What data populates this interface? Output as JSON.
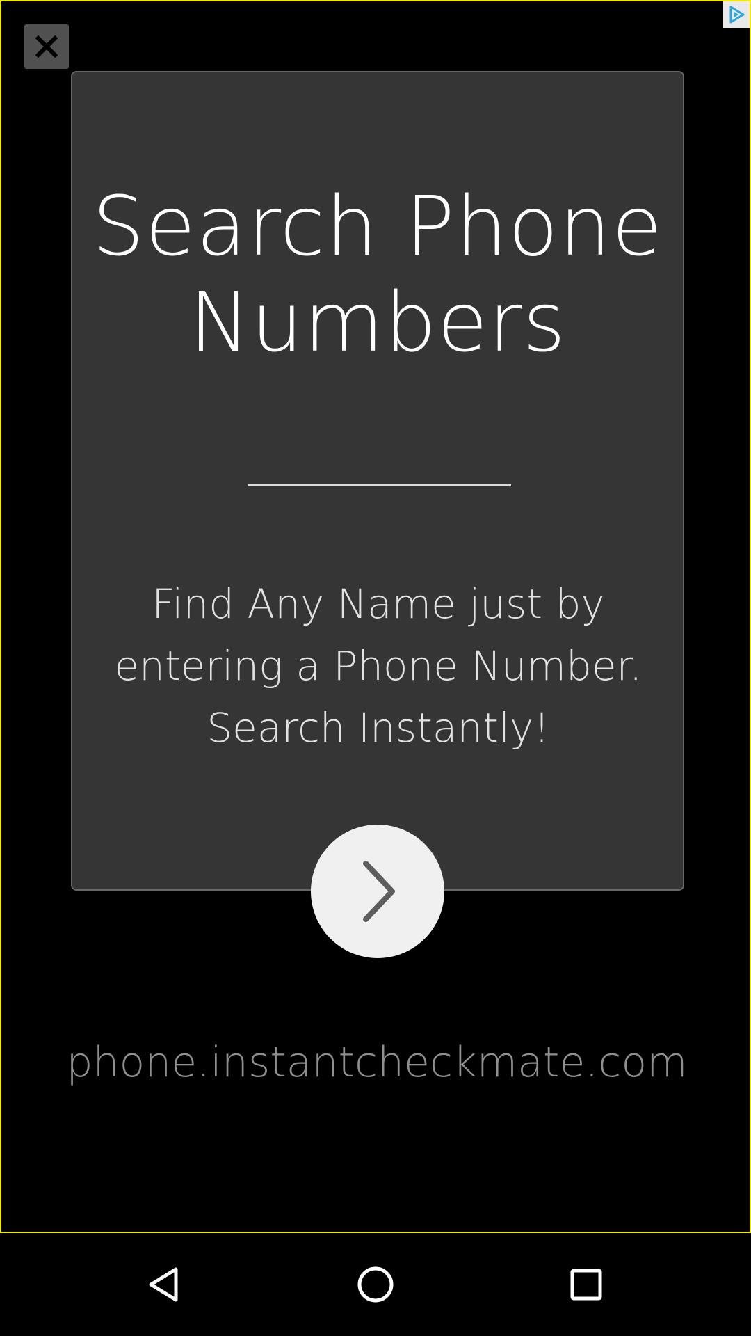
{
  "ad": {
    "close_icon": "close-icon",
    "adchoices_icon": "adchoices-icon",
    "card": {
      "title": "Search Phone Numbers",
      "description": "Find Any Name just by entering a Phone Number. Search Instantly!",
      "next_icon": "chevron-right-icon"
    },
    "domain": "phone.instantcheckmate.com"
  },
  "nav_bar": {
    "back_icon": "back-icon",
    "home_icon": "home-icon",
    "recents_icon": "recents-icon"
  },
  "colors": {
    "frame_border": "#f2ea00",
    "card_background": "#353535",
    "background": "#000000",
    "button_background": "#f0f0f0"
  }
}
